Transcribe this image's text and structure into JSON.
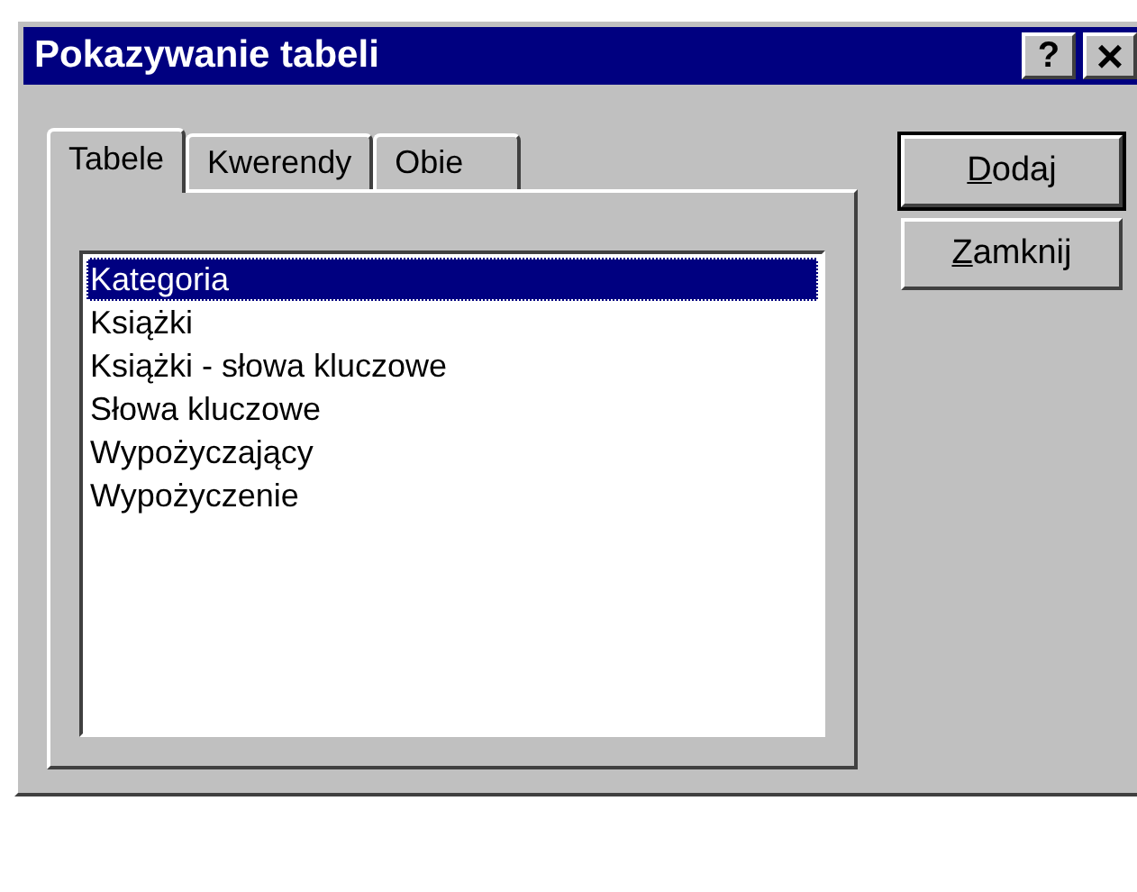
{
  "window": {
    "title": "Pokazywanie tabeli",
    "title_buttons": [
      {
        "kind": "help",
        "label": "?"
      },
      {
        "kind": "close",
        "label": "×"
      }
    ]
  },
  "tabs": [
    {
      "label": "Tabele",
      "selected": true
    },
    {
      "label": "Kwerendy",
      "selected": false
    },
    {
      "label": "Obie",
      "selected": false
    }
  ],
  "list": [
    {
      "label": "Kategoria",
      "selected": true
    },
    {
      "label": "Książki",
      "selected": false
    },
    {
      "label": "Książki - słowa kluczowe",
      "selected": false
    },
    {
      "label": "Słowa kluczowe",
      "selected": false
    },
    {
      "label": "Wypożyczający",
      "selected": false
    },
    {
      "label": "Wypożyczenie",
      "selected": false
    }
  ],
  "buttons": [
    {
      "label": "Dodaj",
      "default": true
    },
    {
      "label": "Zamknij",
      "default": false
    }
  ]
}
